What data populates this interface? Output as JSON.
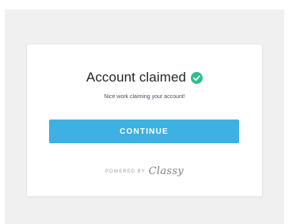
{
  "card": {
    "title": "Account claimed",
    "subtitle": "Nice work claiming your account!",
    "continue_label": "CONTINUE",
    "powered_by": "POWERED BY",
    "brand": "Classy"
  },
  "colors": {
    "accent": "#3db1e3",
    "success": "#2ebf91",
    "background": "#f0f0f1"
  },
  "icons": {
    "title_icon": "check-circle-icon"
  }
}
